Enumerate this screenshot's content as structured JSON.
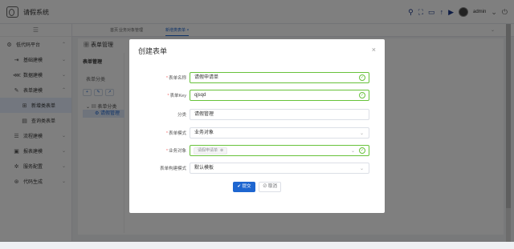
{
  "app": {
    "title": "请假系统",
    "user": "admin"
  },
  "header_icons": [
    "search-icon",
    "fullscreen-icon",
    "monitor-icon",
    "upload-icon",
    "play-icon",
    "power-icon"
  ],
  "sidebar": {
    "collapse_icon": "☰",
    "items": [
      {
        "label": "低代码平台",
        "icon": "gear-icon",
        "glyph": "⚙",
        "chevron": "⌃"
      },
      {
        "label": "基础建模",
        "icon": "login-icon",
        "glyph": "⇥",
        "chevron": "⌄"
      },
      {
        "label": "数据建模",
        "icon": "share-icon",
        "glyph": "⋘",
        "chevron": "⌄"
      },
      {
        "label": "表单建模",
        "icon": "edit-icon",
        "glyph": "✎",
        "chevron": "⌃"
      },
      {
        "label": "新增类表单",
        "icon": "lock-icon",
        "glyph": "⊞"
      },
      {
        "label": "查询类表单",
        "icon": "doc-icon",
        "glyph": "▤"
      },
      {
        "label": "流程建模",
        "icon": "list-icon",
        "glyph": "☰",
        "chevron": "⌄"
      },
      {
        "label": "报表建模",
        "icon": "report-icon",
        "glyph": "▣",
        "chevron": "⌄"
      },
      {
        "label": "服务配置",
        "icon": "settings-icon",
        "glyph": "✲",
        "chevron": "⌄"
      },
      {
        "label": "代码生成",
        "icon": "code-icon",
        "glyph": "⊛",
        "chevron": "⌄"
      }
    ]
  },
  "tabs": [
    {
      "label": "首页"
    },
    {
      "label": "业务对象管理"
    },
    {
      "label": "新增类表单 ×"
    }
  ],
  "page": {
    "title": "表单管理",
    "panel_title": "表单管理",
    "tree_label": "表单分类",
    "tree_root": "表单分类",
    "tree_child": "请假管理",
    "tool_buttons": [
      "+",
      "✎",
      "↗"
    ]
  },
  "dialog": {
    "title": "创建表单",
    "close": "×",
    "fields": [
      {
        "label": "表单名称",
        "required": true,
        "value": "请假申请单",
        "valid": true
      },
      {
        "label": "表单Key",
        "required": true,
        "value": "qjsqd",
        "valid": true
      },
      {
        "label": "分类",
        "required": false,
        "value": "请假管理"
      },
      {
        "label": "表单模式",
        "required": true,
        "value": "业务对象",
        "select": true
      },
      {
        "label": "业务对象",
        "required": true,
        "tag": "请假申请单",
        "select": true,
        "valid": true
      },
      {
        "label": "表单构建模式",
        "required": false,
        "value": "默认模板",
        "select": true
      }
    ],
    "submit_label": "✔ 提交",
    "cancel_label": "⊘ 取消"
  },
  "colors": {
    "primary": "#1e66d0",
    "success": "#67c23a",
    "required": "#f56c6c"
  }
}
